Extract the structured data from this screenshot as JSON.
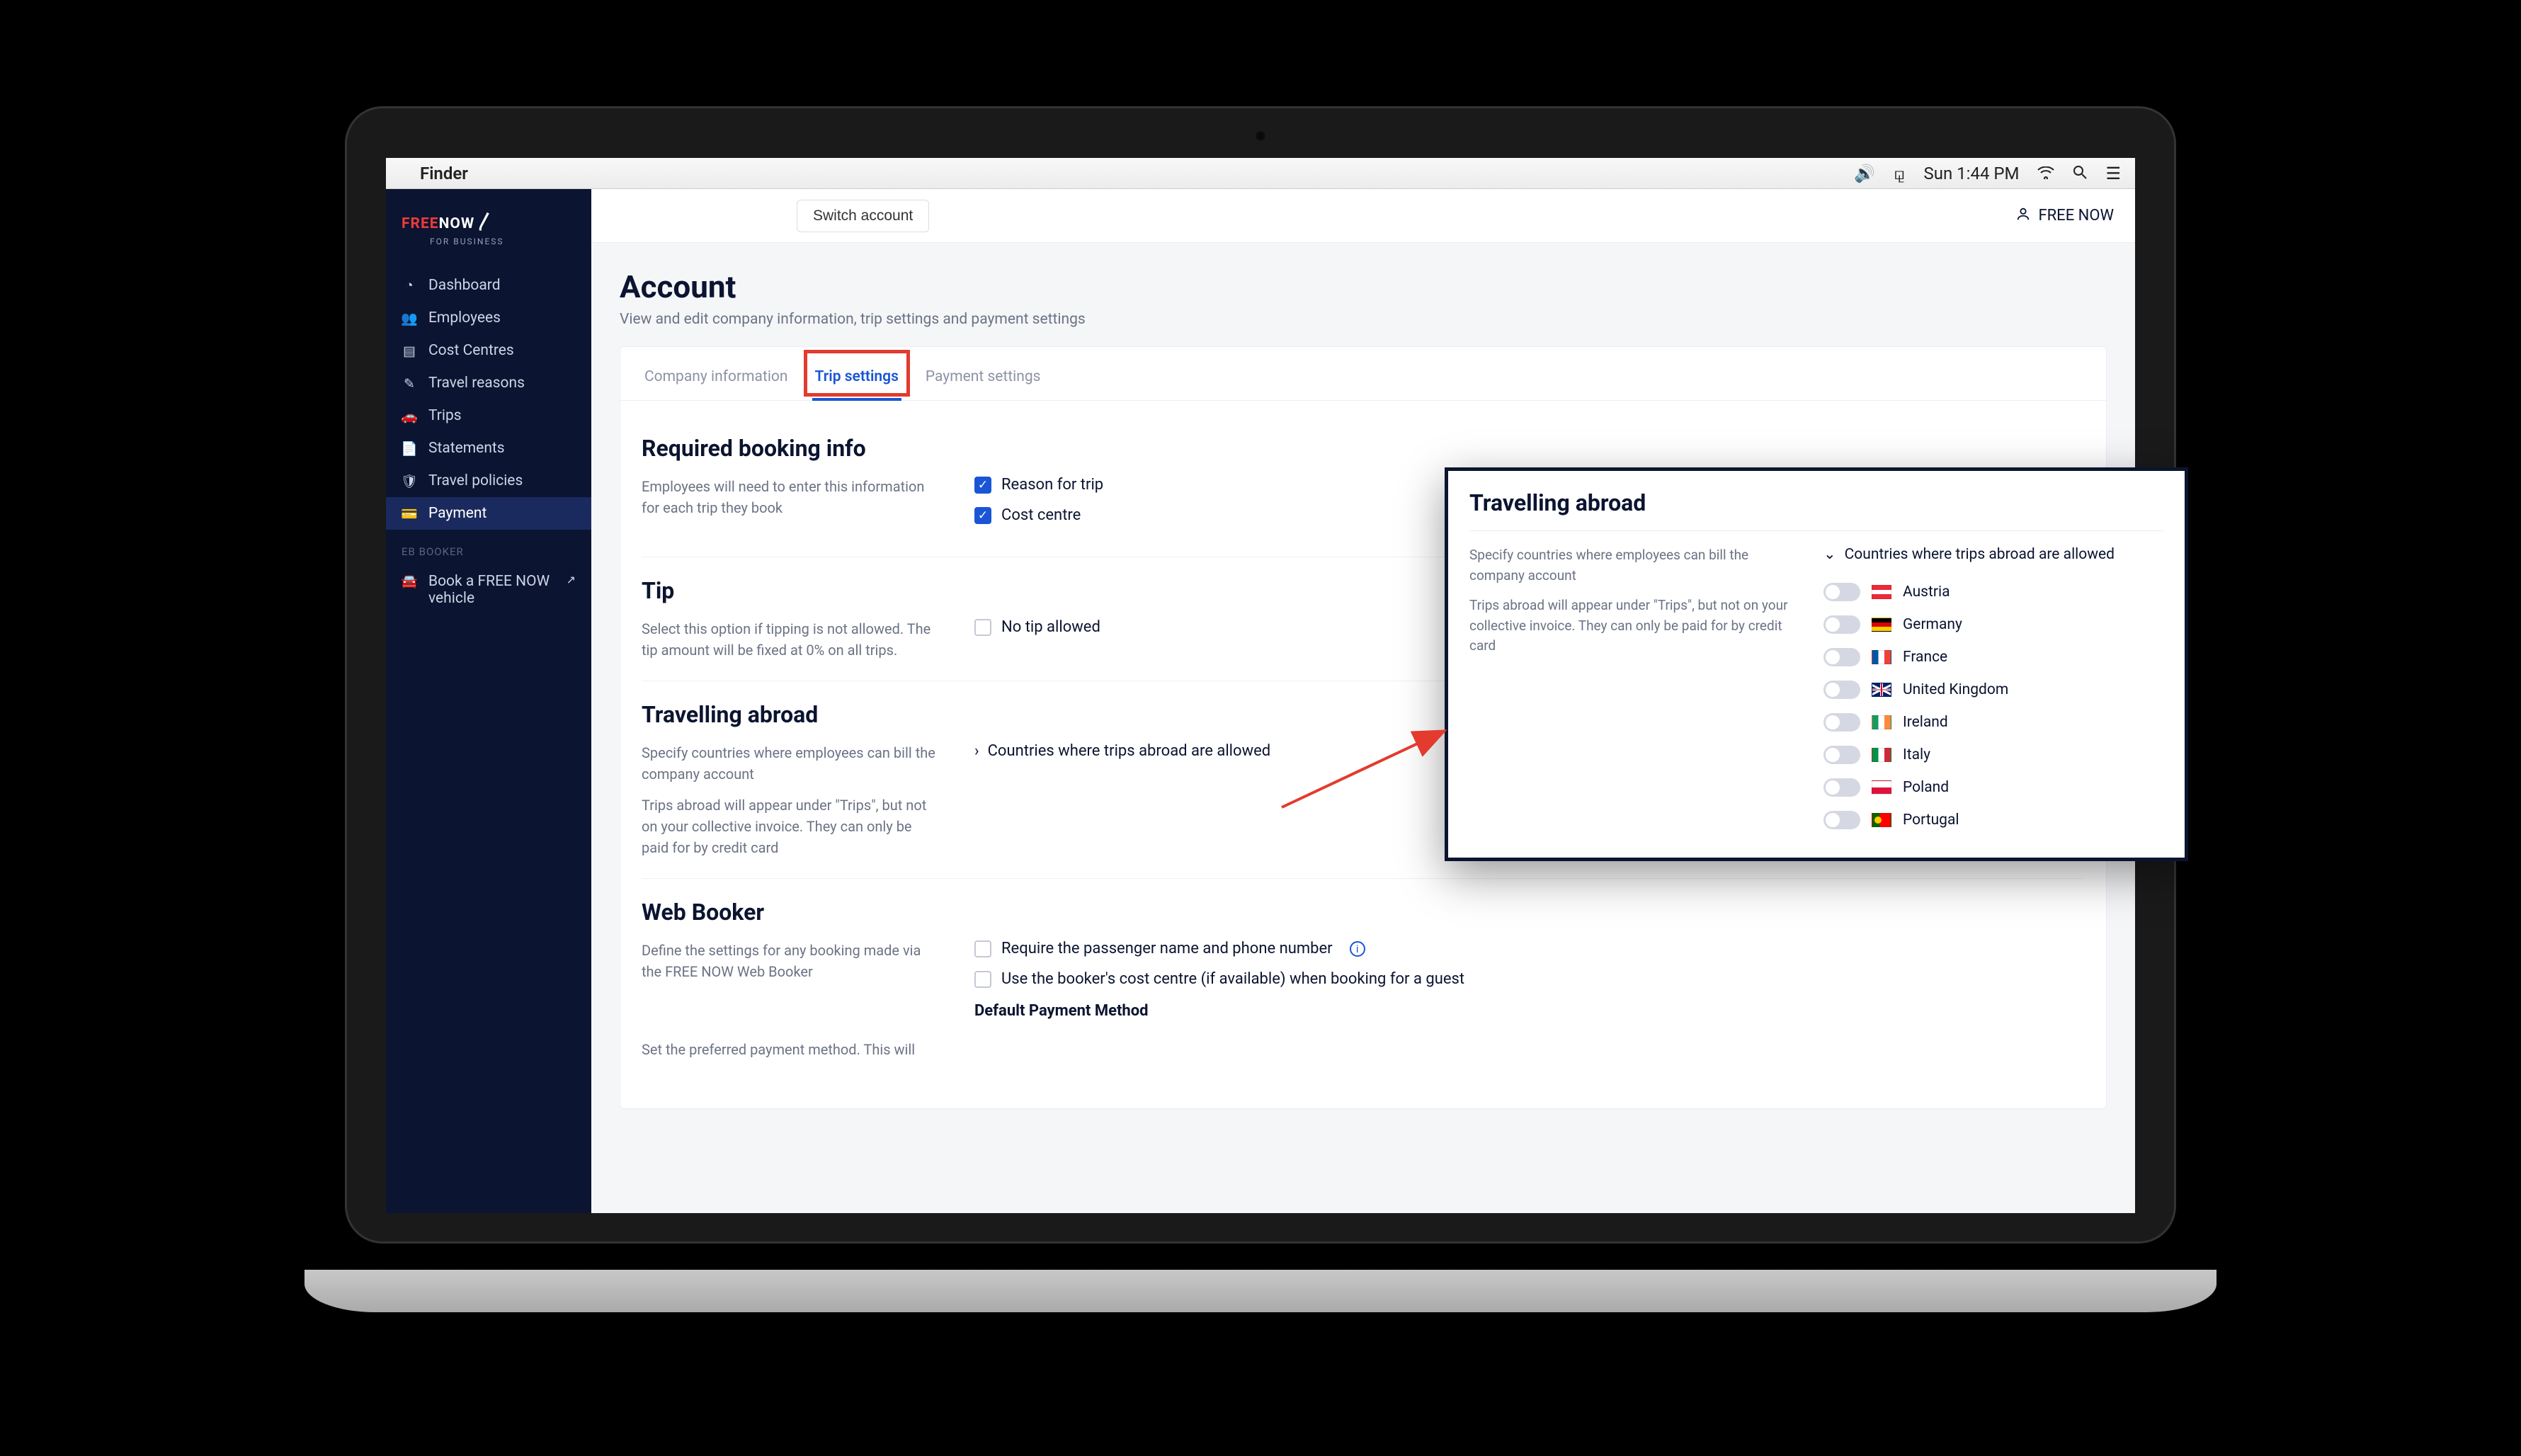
{
  "menubar": {
    "app": "Finder",
    "time": "Sun 1:44 PM"
  },
  "logo": {
    "free": "FREE",
    "now": "NOW",
    "sub": "FOR BUSINESS"
  },
  "sidebar": {
    "items": [
      {
        "icon": "◔",
        "label": "Dashboard"
      },
      {
        "icon": "👥",
        "label": "Employees"
      },
      {
        "icon": "▤",
        "label": "Cost Centres"
      },
      {
        "icon": "✎",
        "label": "Travel reasons"
      },
      {
        "icon": "🚗",
        "label": "Trips"
      },
      {
        "icon": "📄",
        "label": "Statements"
      },
      {
        "icon": "🛡",
        "label": "Travel policies"
      },
      {
        "icon": "💳",
        "label": "Payment"
      }
    ],
    "booker_section": "EB BOOKER",
    "book_label": "Book a FREE NOW vehicle"
  },
  "topbar": {
    "switch": "Switch account",
    "company": "FREE NOW"
  },
  "page": {
    "title": "Account",
    "subtitle": "View and edit company information, trip settings and payment settings"
  },
  "tabs": [
    {
      "label": "Company information",
      "active": false
    },
    {
      "label": "Trip settings",
      "active": true
    },
    {
      "label": "Payment settings",
      "active": false
    }
  ],
  "required": {
    "heading": "Required booking info",
    "desc": "Employees will need to enter this information for each trip they book",
    "opts": [
      {
        "label": "Reason for trip",
        "checked": true
      },
      {
        "label": "Cost centre",
        "checked": true
      }
    ]
  },
  "tip": {
    "heading": "Tip",
    "desc": "Select this option if tipping is not allowed. The tip amount will be fixed at 0% on all trips.",
    "opts": [
      {
        "label": "No tip allowed",
        "checked": false
      }
    ]
  },
  "abroad": {
    "heading": "Travelling abroad",
    "desc1": "Specify countries where employees can bill the company account",
    "desc2": "Trips abroad will appear under \"Trips\", but not on your collective invoice. They can only be paid for by credit card",
    "expander": "Countries where trips abroad are allowed"
  },
  "webbooker": {
    "heading": "Web Booker",
    "desc": "Define the settings for any booking made via the FREE NOW Web Booker",
    "opts": [
      {
        "label": "Require the passenger name and phone number",
        "checked": false,
        "info": true
      },
      {
        "label": "Use the booker's cost centre (if available) when booking for a guest",
        "checked": false
      }
    ],
    "desc2": "Set the preferred payment method. This will",
    "default_label": "Default Payment Method"
  },
  "popout": {
    "heading": "Travelling abroad",
    "desc1": "Specify countries where employees can bill the company account",
    "desc2": "Trips abroad will appear under \"Trips\", but not on your collective invoice. They can only be paid for by credit card",
    "expander": "Countries where trips abroad are allowed",
    "countries": [
      {
        "name": "Austria",
        "flag": "at"
      },
      {
        "name": "Germany",
        "flag": "de"
      },
      {
        "name": "France",
        "flag": "fr"
      },
      {
        "name": "United Kingdom",
        "flag": "gb"
      },
      {
        "name": "Ireland",
        "flag": "ie"
      },
      {
        "name": "Italy",
        "flag": "it"
      },
      {
        "name": "Poland",
        "flag": "pl"
      },
      {
        "name": "Portugal",
        "flag": "pt"
      }
    ]
  }
}
